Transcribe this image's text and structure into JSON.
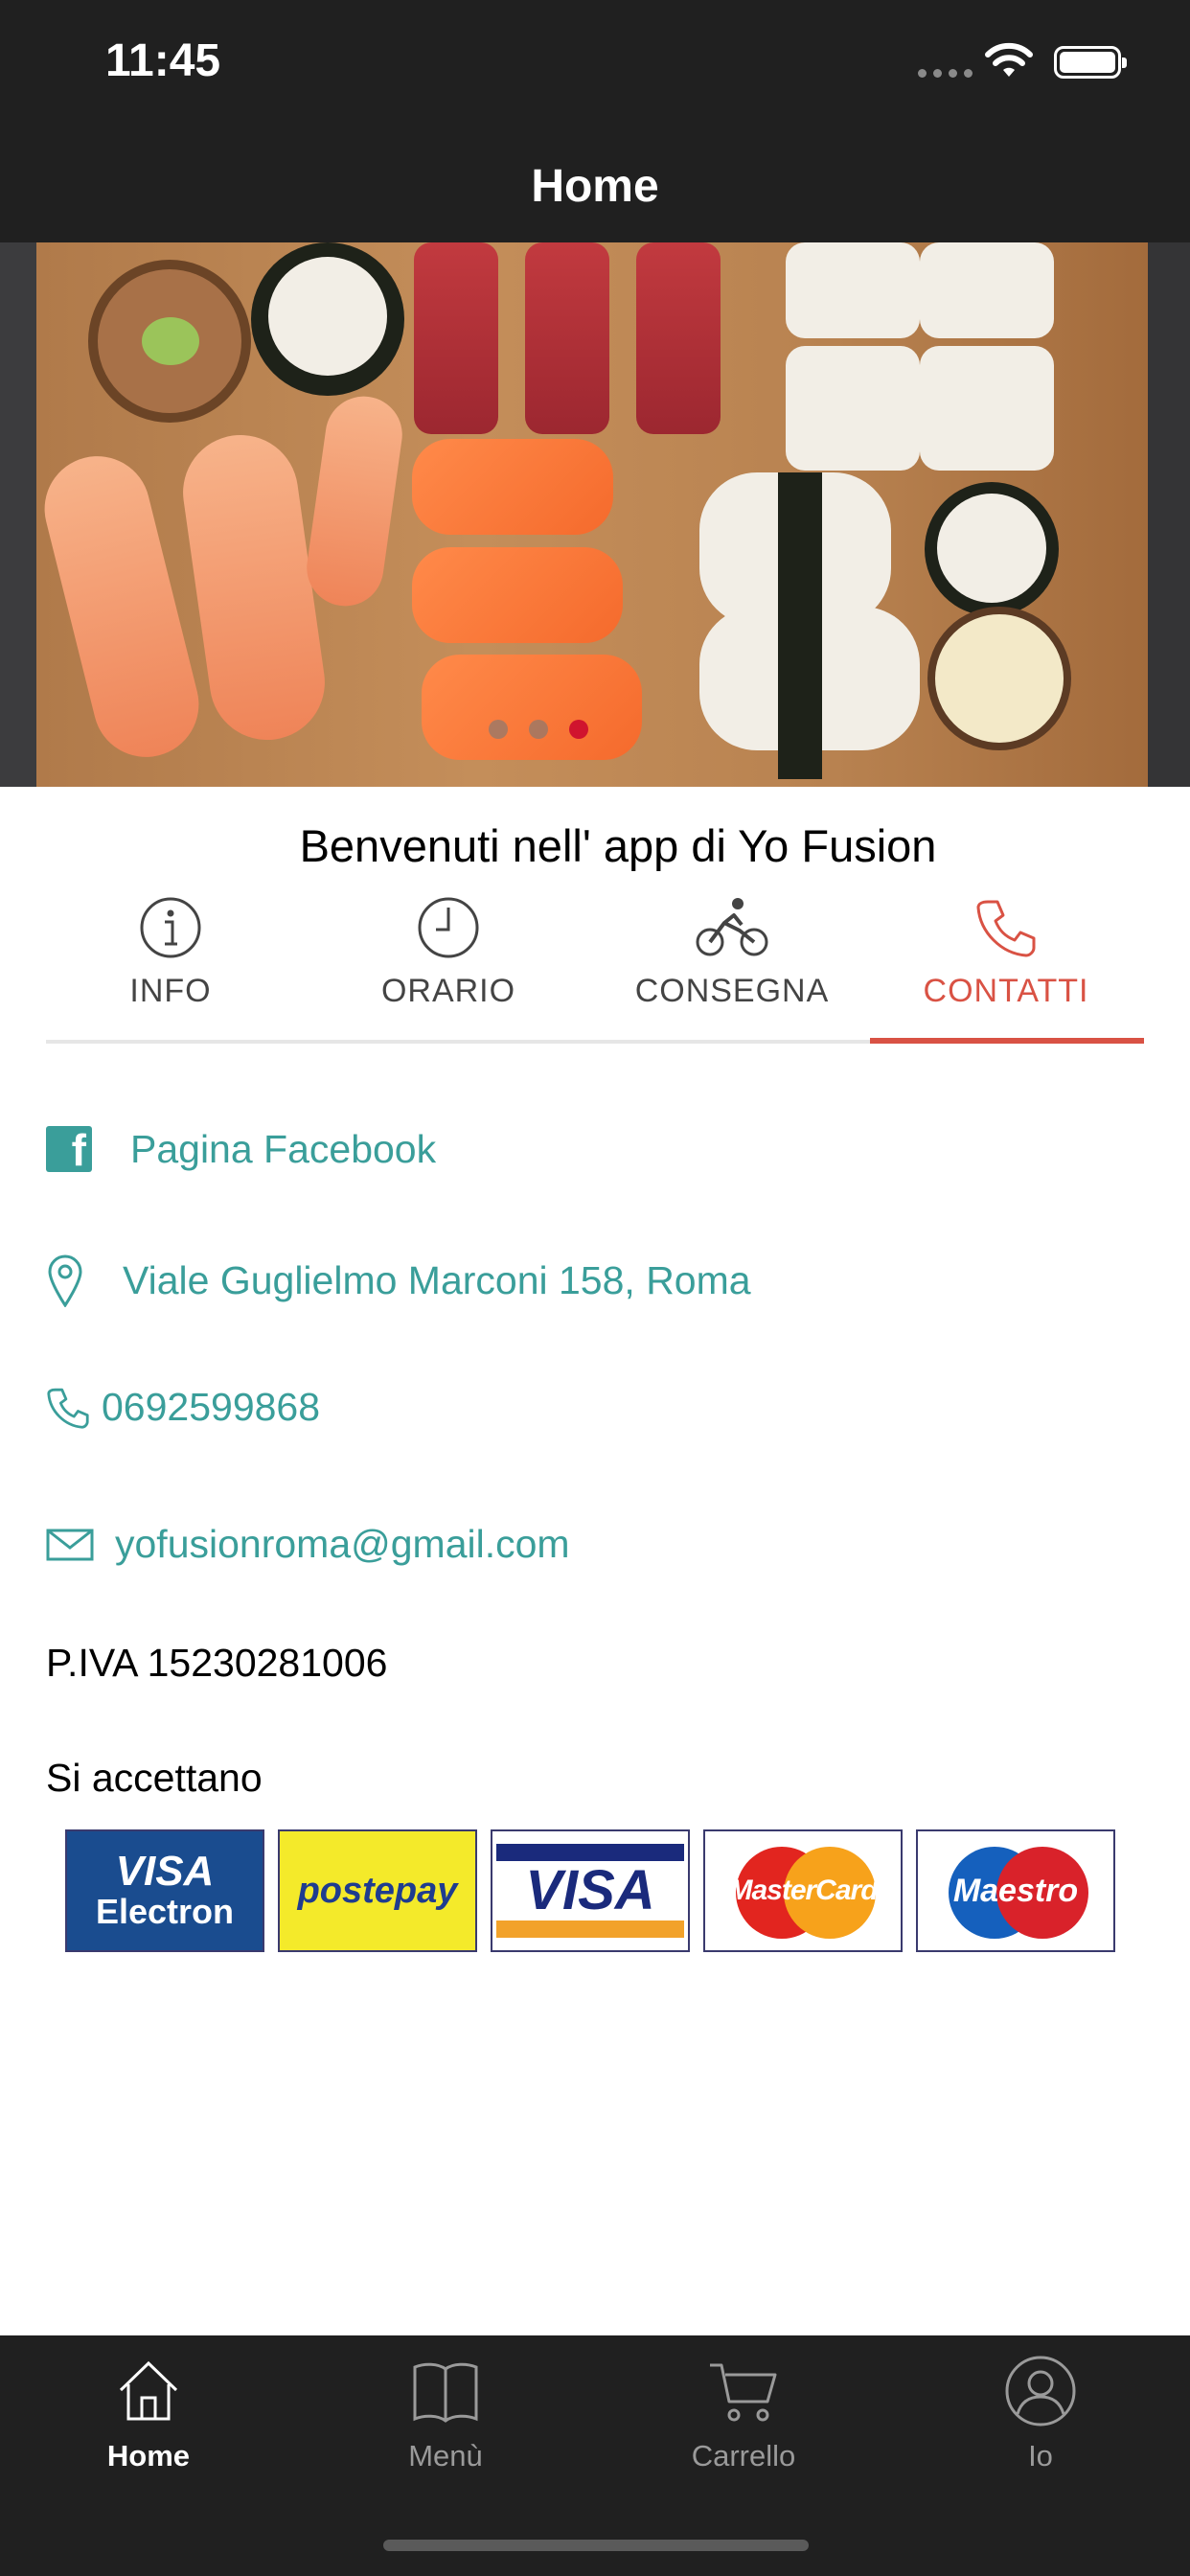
{
  "status": {
    "time": "11:45"
  },
  "nav": {
    "title": "Home"
  },
  "hero": {
    "slides": 3,
    "active_slide": 3
  },
  "welcome": "Benvenuti nell' app di Yo Fusion",
  "tabs": [
    {
      "label": "INFO",
      "icon": "info-icon",
      "active": false
    },
    {
      "label": "ORARIO",
      "icon": "clock-icon",
      "active": false
    },
    {
      "label": "CONSEGNA",
      "icon": "bicycle-icon",
      "active": false
    },
    {
      "label": "CONTATTI",
      "icon": "phone-icon",
      "active": true
    }
  ],
  "contacts": {
    "facebook": "Pagina Facebook",
    "address": "Viale Guglielmo Marconi 158, Roma",
    "phone": "0692599868",
    "email": "yofusionroma@gmail.com"
  },
  "piva": "P.IVA 15230281006",
  "accept_label": "Si accettano",
  "payment_cards": {
    "visa_electron": {
      "line1": "VISA",
      "line2": "Electron"
    },
    "postepay": "postepay",
    "visa": "VISA",
    "mastercard": "MasterCard",
    "maestro": "Maestro"
  },
  "bottom_tabs": [
    {
      "label": "Home",
      "icon": "home-icon",
      "active": true
    },
    {
      "label": "Menù",
      "icon": "book-icon",
      "active": false
    },
    {
      "label": "Carrello",
      "icon": "cart-icon",
      "active": false
    },
    {
      "label": "Io",
      "icon": "user-icon",
      "active": false
    }
  ],
  "colors": {
    "accent": "#d95244",
    "link": "#3a9e9a",
    "bar": "#202020"
  }
}
